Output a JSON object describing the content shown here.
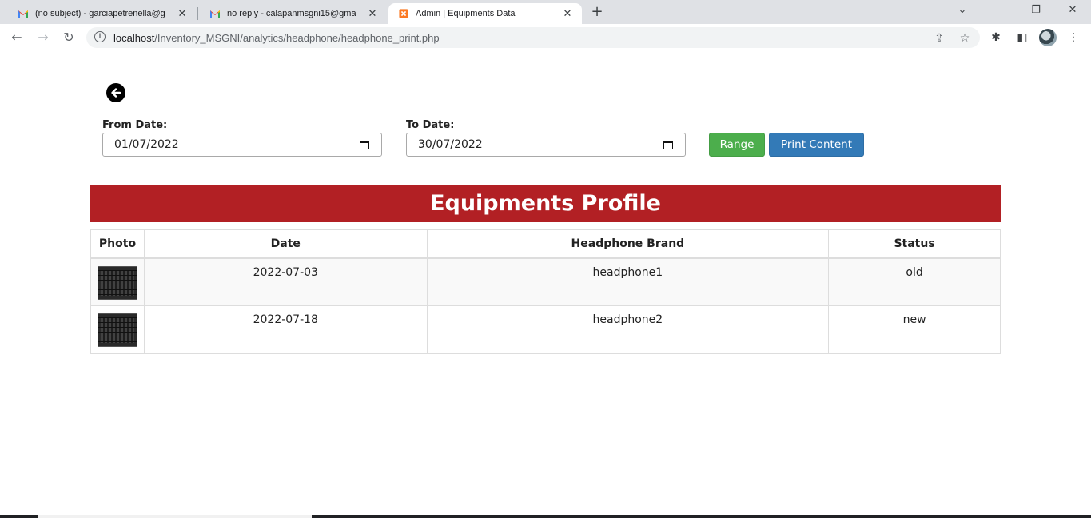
{
  "browser": {
    "tabs": [
      {
        "title": "(no subject) - garciapetrenella@g",
        "favicon": "gmail-icon",
        "active": false
      },
      {
        "title": "no reply - calapanmsgni15@gma",
        "favicon": "gmail-icon",
        "active": false
      },
      {
        "title": "Admin | Equipments Data",
        "favicon": "xampp-icon",
        "active": true
      }
    ],
    "url_host": "localhost",
    "url_path": "/Inventory_MSGNI/analytics/headphone/headphone_print.php"
  },
  "filters": {
    "from_label": "From Date:",
    "from_value": "01/07/2022",
    "to_label": "To Date:",
    "to_value": "30/07/2022",
    "range_button": "Range",
    "print_button": "Print Content"
  },
  "report": {
    "title": "Equipments Profile",
    "columns": [
      "Photo",
      "Date",
      "Headphone Brand",
      "Status"
    ],
    "rows": [
      {
        "date": "2022-07-03",
        "brand": "headphone1",
        "status": "old"
      },
      {
        "date": "2022-07-18",
        "brand": "headphone2",
        "status": "new"
      }
    ]
  },
  "colors": {
    "banner": "#b22024",
    "range_button": "#4cae4c",
    "print_button": "#337ab7"
  }
}
